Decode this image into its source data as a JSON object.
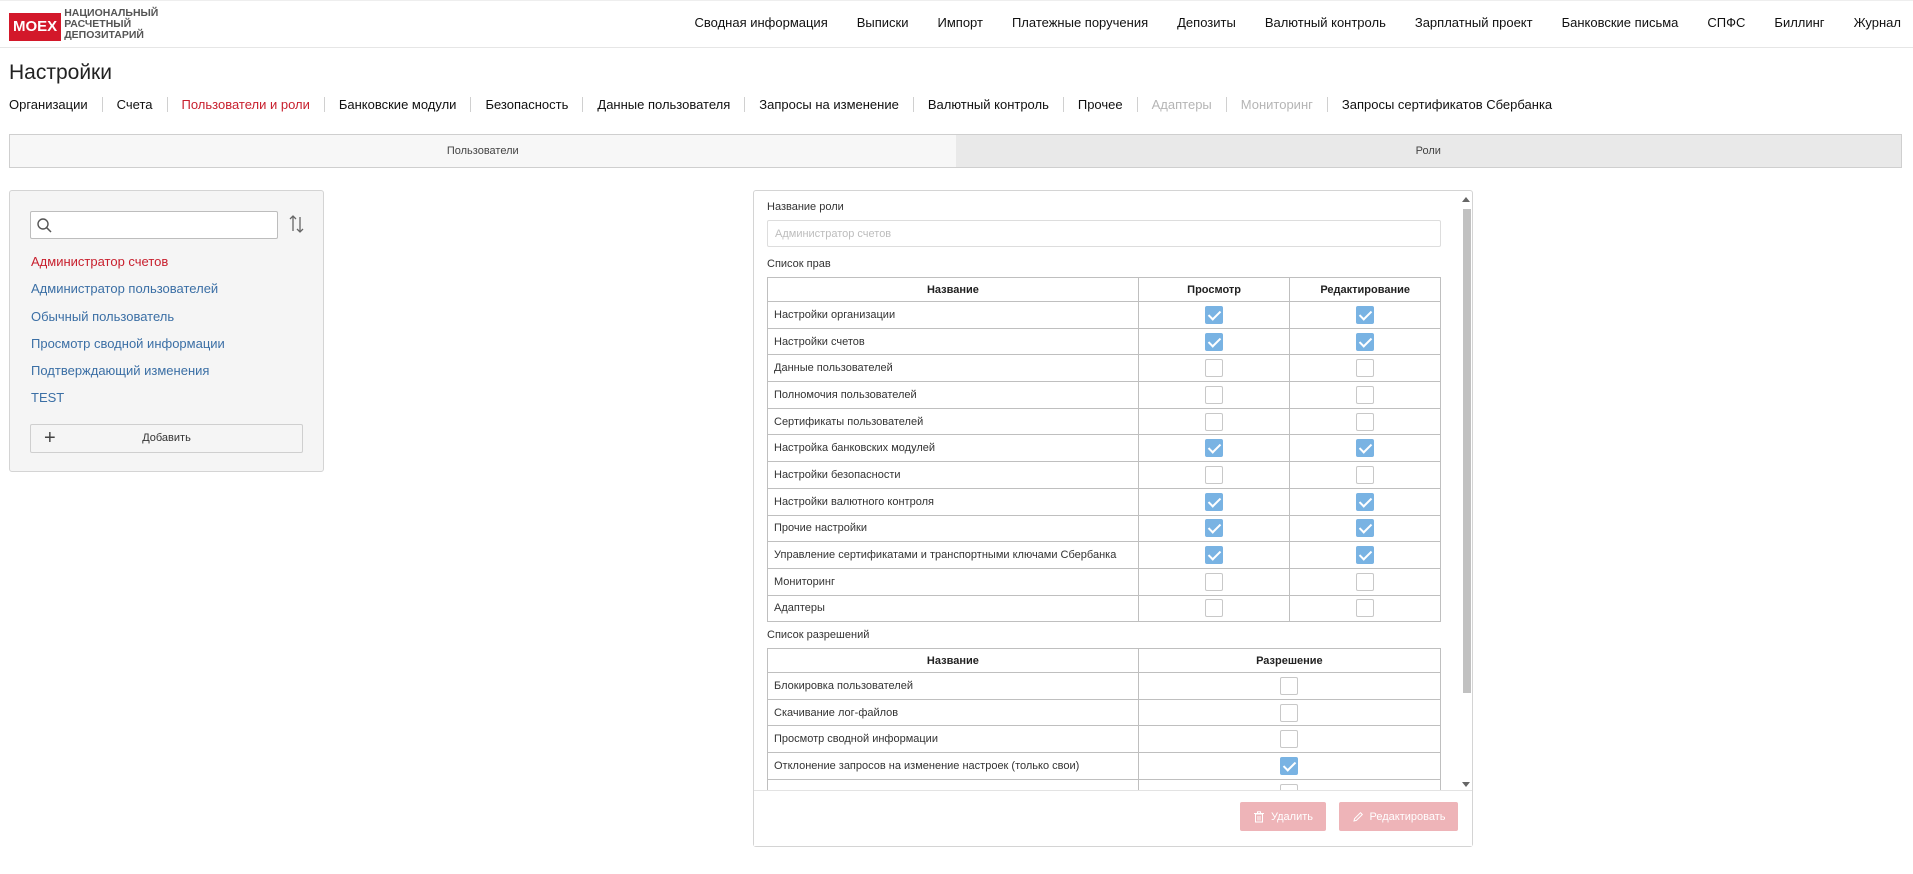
{
  "header": {
    "logo_mark": "MOEX",
    "logo_lines": [
      "НАЦИОНАЛЬНЫЙ",
      "РАСЧЕТНЫЙ",
      "ДЕПОЗИТАРИЙ"
    ],
    "nav": [
      "Сводная информация",
      "Выписки",
      "Импорт",
      "Платежные поручения",
      "Депозиты",
      "Валютный контроль",
      "Зарплатный проект",
      "Банковские письма",
      "СПФС",
      "Биллинг",
      "Журнал"
    ]
  },
  "page_title": "Настройки",
  "subtabs": [
    {
      "label": "Организации",
      "state": "normal"
    },
    {
      "label": "Счета",
      "state": "normal"
    },
    {
      "label": "Пользователи и роли",
      "state": "active"
    },
    {
      "label": "Банковские модули",
      "state": "normal"
    },
    {
      "label": "Безопасность",
      "state": "normal"
    },
    {
      "label": "Данные пользователя",
      "state": "normal"
    },
    {
      "label": "Запросы на изменение",
      "state": "normal"
    },
    {
      "label": "Валютный контроль",
      "state": "normal"
    },
    {
      "label": "Прочее",
      "state": "normal"
    },
    {
      "label": "Адаптеры",
      "state": "disabled"
    },
    {
      "label": "Мониторинг",
      "state": "disabled"
    },
    {
      "label": "Запросы сертификатов Сбербанка",
      "state": "normal"
    }
  ],
  "segment": {
    "users": "Пользователи",
    "roles": "Роли"
  },
  "roles_panel": {
    "search_placeholder": "",
    "roles": [
      "Администратор счетов",
      "Администратор пользователей",
      "Обычный пользователь",
      "Просмотр сводной информации",
      "Подтверждающий изменения",
      "TEST"
    ],
    "active_index": 0,
    "add_label": "Добавить"
  },
  "role_form": {
    "name_label": "Название роли",
    "name_value": "Администратор счетов",
    "rights_label": "Список прав",
    "rights_headers": {
      "name": "Название",
      "view": "Просмотр",
      "edit": "Редактирование"
    },
    "rights": [
      {
        "name": "Настройки организации",
        "view": true,
        "edit": true
      },
      {
        "name": "Настройки счетов",
        "view": true,
        "edit": true
      },
      {
        "name": "Данные пользователей",
        "view": false,
        "edit": false
      },
      {
        "name": "Полномочия пользователей",
        "view": false,
        "edit": false
      },
      {
        "name": "Сертификаты пользователей",
        "view": false,
        "edit": false
      },
      {
        "name": "Настройка банковских модулей",
        "view": true,
        "edit": true
      },
      {
        "name": "Настройки безопасности",
        "view": false,
        "edit": false
      },
      {
        "name": "Настройки валютного контроля",
        "view": true,
        "edit": true
      },
      {
        "name": "Прочие настройки",
        "view": true,
        "edit": true
      },
      {
        "name": "Управление сертификатами и транспортными ключами Сбербанка",
        "view": true,
        "edit": true
      },
      {
        "name": "Мониторинг",
        "view": false,
        "edit": false
      },
      {
        "name": "Адаптеры",
        "view": false,
        "edit": false
      }
    ],
    "perms_label": "Список разрешений",
    "perms_headers": {
      "name": "Название",
      "allow": "Разрешение"
    },
    "perms": [
      {
        "name": "Блокировка пользователей",
        "allow": false
      },
      {
        "name": "Скачивание лог-файлов",
        "allow": false
      },
      {
        "name": "Просмотр сводной информации",
        "allow": false
      },
      {
        "name": "Отклонение запросов на изменение настроек (только свои)",
        "allow": true
      },
      {
        "name": "",
        "allow": false
      }
    ],
    "delete_label": "Удалить",
    "edit_label": "Редактировать"
  },
  "colors": {
    "accent": "#c8202e",
    "link": "#3b6fa5",
    "checkbox_on": "#79b3e3",
    "button_disabled": "#eeb4b8"
  }
}
